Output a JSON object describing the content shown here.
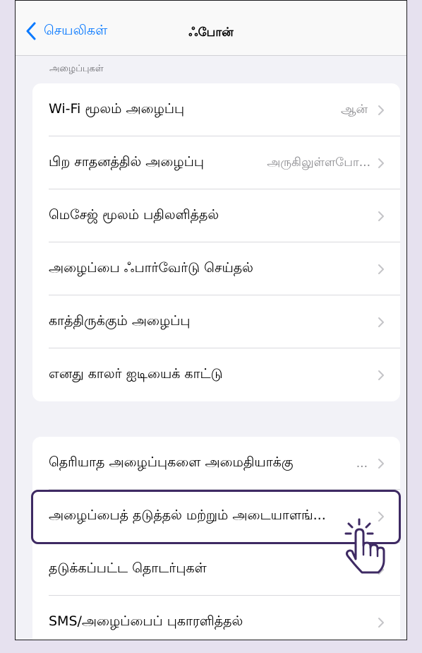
{
  "nav": {
    "back_label": "செயலிகள்",
    "title": "ஃபோன்"
  },
  "section_calls": {
    "header": "அழைப்புகள்"
  },
  "group1": [
    {
      "label": "Wi-Fi மூலம் அழைப்பு",
      "value": "ஆன்"
    },
    {
      "label": "பிற சாதனத்தில் அழைப்பு",
      "value": "அருகிலுள்ளபோ..."
    },
    {
      "label": "மெசேஜ் மூலம் பதிலளித்தல்",
      "value": ""
    },
    {
      "label": "அழைப்பை ஃபார்வேர்டு செய்தல்",
      "value": ""
    },
    {
      "label": "காத்திருக்கும் அழைப்பு",
      "value": ""
    },
    {
      "label": "எனது காலர் ஐடியைக் காட்டு",
      "value": ""
    }
  ],
  "group2": [
    {
      "label": "தெரியாத அழைப்புகளை அமைதியாக்கு",
      "value": "..."
    },
    {
      "label": "அழைப்பைத் தடுத்தல் மற்றும் அடையாளங்...",
      "value": ""
    },
    {
      "label": "தடுக்கப்பட்ட தொடர்புகள்",
      "value": ""
    },
    {
      "label": "SMS/அழைப்பைப் புகாரளித்தல்",
      "value": ""
    }
  ],
  "colors": {
    "accent": "#0a7aff",
    "highlight": "#3e2a63",
    "background": "#f2f2f7"
  },
  "icons": {
    "back": "chevron-left-icon",
    "row": "chevron-right-icon",
    "pointer": "tap-hand-icon"
  }
}
